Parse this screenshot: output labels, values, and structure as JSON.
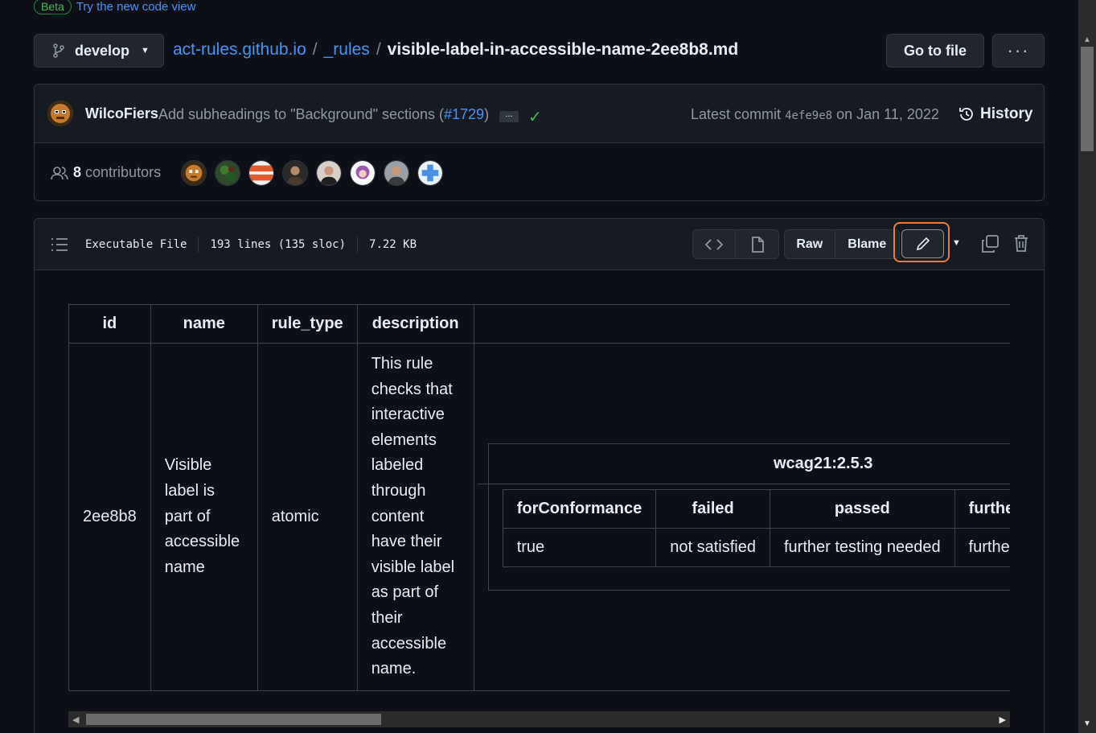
{
  "beta": {
    "badge": "Beta",
    "link": "Try the new code view"
  },
  "repo": {
    "branch": "develop",
    "breadcrumb": {
      "repo": "act-rules.github.io",
      "sep1": "/",
      "folder": "_rules",
      "sep2": "/",
      "file": "visible-label-in-accessible-name-2ee8b8.md"
    },
    "go_to_file": "Go to file",
    "more": "···"
  },
  "commit": {
    "author": "WilcoFiers",
    "message_prefix": "Add subheadings to \"Background\" sections (",
    "pr": "#1729",
    "message_suffix": ")",
    "ellipsis": "...",
    "latest_label": "Latest commit",
    "sha": "4efe9e8",
    "date": "on Jan 11, 2022",
    "history": "History",
    "contributors_count": "8",
    "contributors_label": "contributors"
  },
  "file": {
    "type": "Executable File",
    "lines": "193 lines (135 sloc)",
    "size": "7.22 KB",
    "raw": "Raw",
    "blame": "Blame"
  },
  "table": {
    "headers": [
      "id",
      "name",
      "rule_type",
      "description"
    ],
    "row": {
      "id": "2ee8b8",
      "name": "Visible label is part of accessible name",
      "rule_type": "atomic",
      "description": "This rule checks that interactive elements labeled through content have their visible label as part of their accessible name."
    },
    "accessibility": {
      "key": "wcag21:2.5.3",
      "headers": [
        "forConformance",
        "failed",
        "passed",
        "further testing needed"
      ],
      "values": [
        "true",
        "not satisfied",
        "further testing needed",
        "further testing needed"
      ]
    }
  },
  "colors": {
    "link": "#4493f8",
    "success": "#3fb950",
    "highlight": "#ec7a3f",
    "bg": "#0d1117"
  }
}
